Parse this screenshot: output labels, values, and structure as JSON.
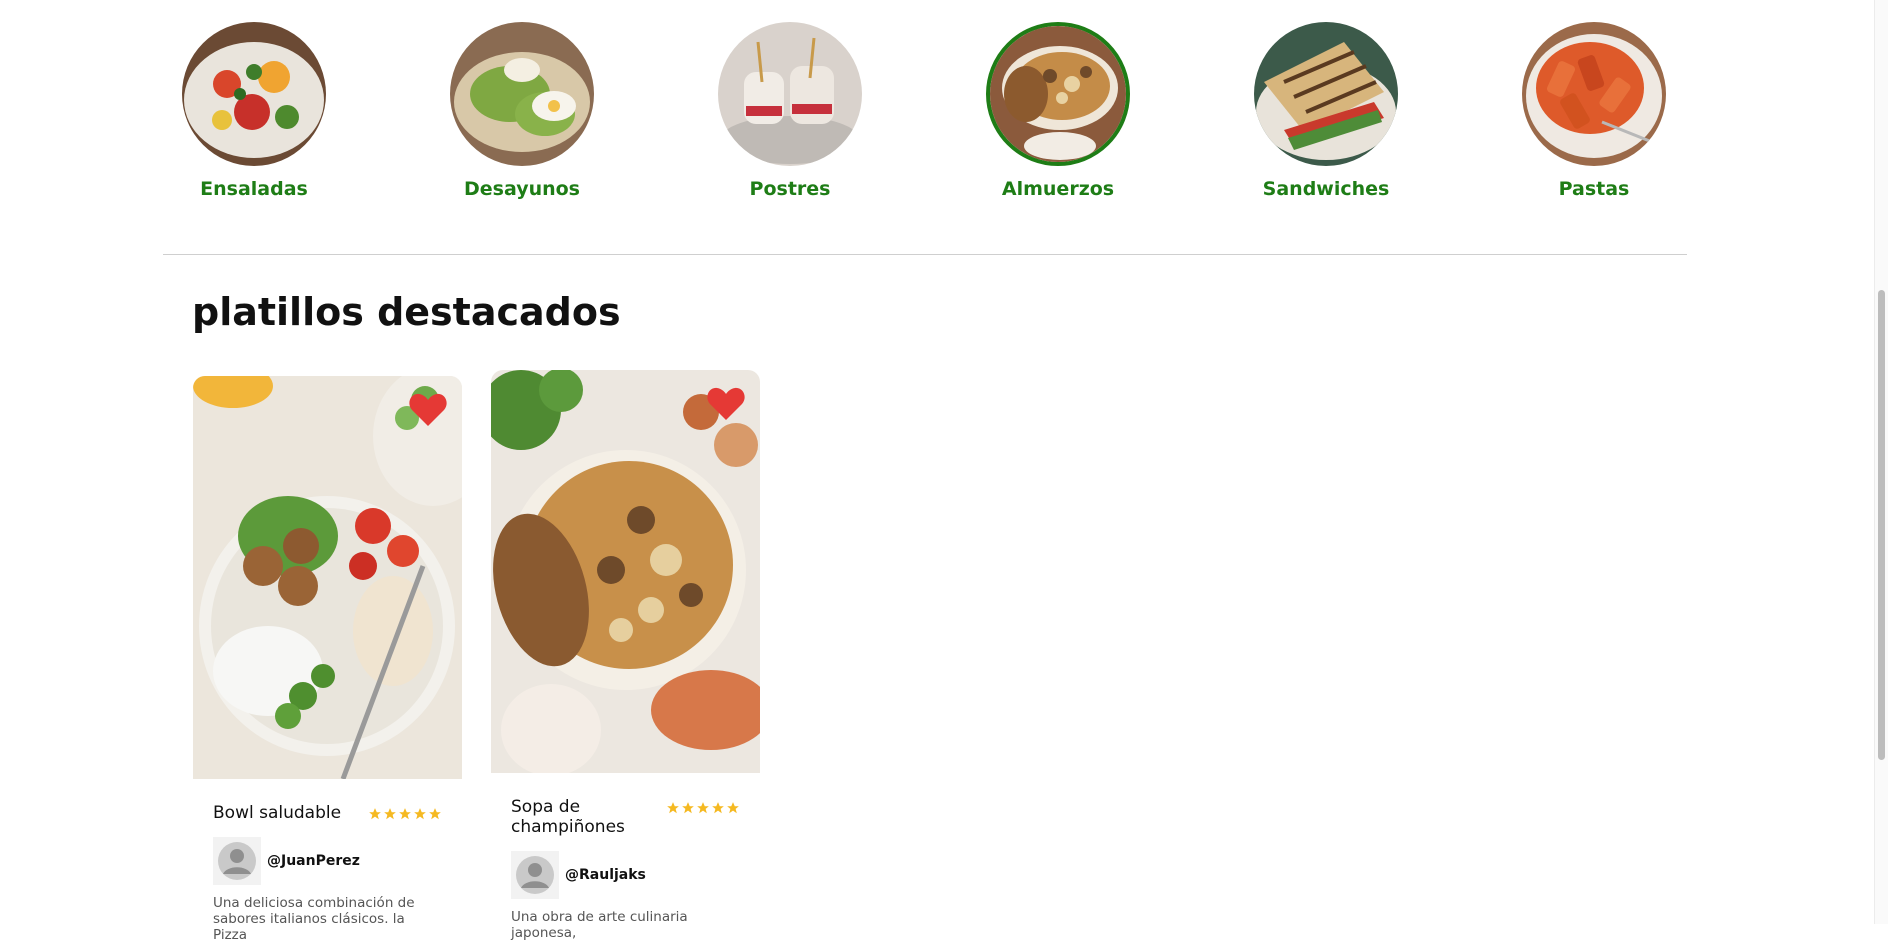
{
  "categories": [
    {
      "label": "Ensaladas",
      "active": false
    },
    {
      "label": "Desayunos",
      "active": false
    },
    {
      "label": "Postres",
      "active": false
    },
    {
      "label": "Almuerzos",
      "active": true
    },
    {
      "label": "Sandwiches",
      "active": false
    },
    {
      "label": "Pastas",
      "active": false
    }
  ],
  "featured": {
    "title": "platillos destacados",
    "cards": [
      {
        "title": "Bowl saludable",
        "rating": 5,
        "user": "@JuanPerez",
        "description": "Una deliciosa combinación de sabores italianos clásicos. la Pizza"
      },
      {
        "title": "Sopa de champiñones",
        "rating": 5,
        "user": "@Rauljaks",
        "description": "Una obra de arte culinaria japonesa,"
      }
    ]
  },
  "colors": {
    "accent": "#1e7d16",
    "heart": "#e53935",
    "star": "#f5b921"
  }
}
